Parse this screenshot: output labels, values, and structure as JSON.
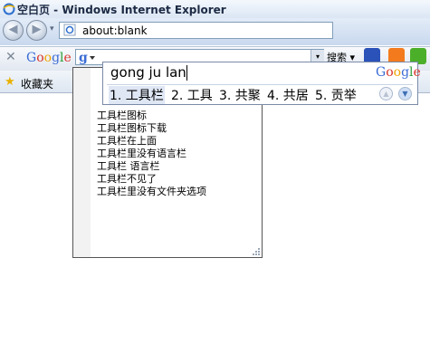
{
  "window": {
    "title": "空白页 - Windows Internet Explorer"
  },
  "nav": {
    "back_glyph": "◀",
    "forward_glyph": "▶",
    "dropdown_glyph": "▾",
    "address": "about:blank"
  },
  "toolbar": {
    "close_glyph": "✕",
    "search_button": "搜索 ▾",
    "search_dropdown_glyph": "▾"
  },
  "favorites": {
    "label": "收藏夹",
    "star_glyph": "★"
  },
  "suggestions": [
    "工具栏图标",
    "工具栏图标下载",
    "工具栏在上面",
    "工具栏里没有语言栏",
    "工具栏 语言栏",
    "工具栏不见了",
    "工具栏里没有文件夹选项"
  ],
  "ime": {
    "pinyin": "gong ju lan",
    "candidates": [
      "1. 工具栏",
      "2. 工具",
      "3. 共聚",
      "4. 共居",
      "5. 贡举"
    ],
    "prev_glyph": "▲",
    "next_glyph": "▼"
  },
  "brand": {
    "google_letters": [
      "G",
      "o",
      "o",
      "g",
      "l",
      "e"
    ],
    "colors": [
      "#3b6cd5",
      "#d9342b",
      "#f0a400",
      "#3b6cd5",
      "#2e9d3a",
      "#d9342b"
    ]
  },
  "colors": {
    "titlebar": "#dbe6f4",
    "toolbar": "#c9d8ee",
    "selection": "#dfe7f5"
  }
}
